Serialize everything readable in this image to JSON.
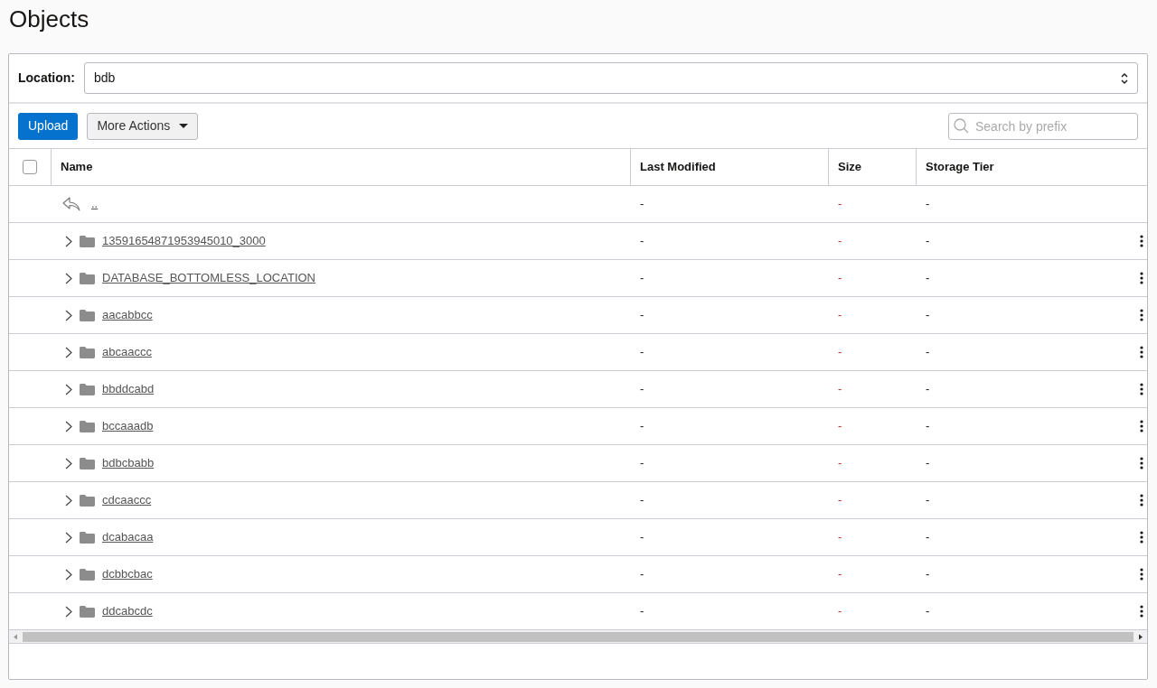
{
  "title": "Objects",
  "location": {
    "label": "Location:",
    "value": "bdb"
  },
  "toolbar": {
    "upload": "Upload",
    "more_actions": "More Actions",
    "search": {
      "placeholder": "Search by prefix"
    }
  },
  "table": {
    "select_all": {
      "checked": false
    },
    "columns": [
      "Name",
      "Last Modified",
      "Size",
      "Storage Tier"
    ],
    "rows": [
      {
        "kind": "parent",
        "name": "..",
        "last_modified": "-",
        "size": "-",
        "storage_tier": "-"
      },
      {
        "kind": "folder",
        "name": "13591654871953945010_3000",
        "last_modified": "-",
        "size": "-",
        "storage_tier": "-"
      },
      {
        "kind": "folder",
        "name": "DATABASE_BOTTOMLESS_LOCATION",
        "last_modified": "-",
        "size": "-",
        "storage_tier": "-"
      },
      {
        "kind": "folder",
        "name": "aacabbcc",
        "last_modified": "-",
        "size": "-",
        "storage_tier": "-"
      },
      {
        "kind": "folder",
        "name": "abcaaccc",
        "last_modified": "-",
        "size": "-",
        "storage_tier": "-"
      },
      {
        "kind": "folder",
        "name": "bbddcabd",
        "last_modified": "-",
        "size": "-",
        "storage_tier": "-"
      },
      {
        "kind": "folder",
        "name": "bccaaadb",
        "last_modified": "-",
        "size": "-",
        "storage_tier": "-"
      },
      {
        "kind": "folder",
        "name": "bdbcbabb",
        "last_modified": "-",
        "size": "-",
        "storage_tier": "-"
      },
      {
        "kind": "folder",
        "name": "cdcaaccc",
        "last_modified": "-",
        "size": "-",
        "storage_tier": "-"
      },
      {
        "kind": "folder",
        "name": "dcabacaa",
        "last_modified": "-",
        "size": "-",
        "storage_tier": "-"
      },
      {
        "kind": "folder",
        "name": "dcbbcbac",
        "last_modified": "-",
        "size": "-",
        "storage_tier": "-"
      },
      {
        "kind": "folder",
        "name": "ddcabcdc",
        "last_modified": "-",
        "size": "-",
        "storage_tier": "-"
      }
    ]
  }
}
